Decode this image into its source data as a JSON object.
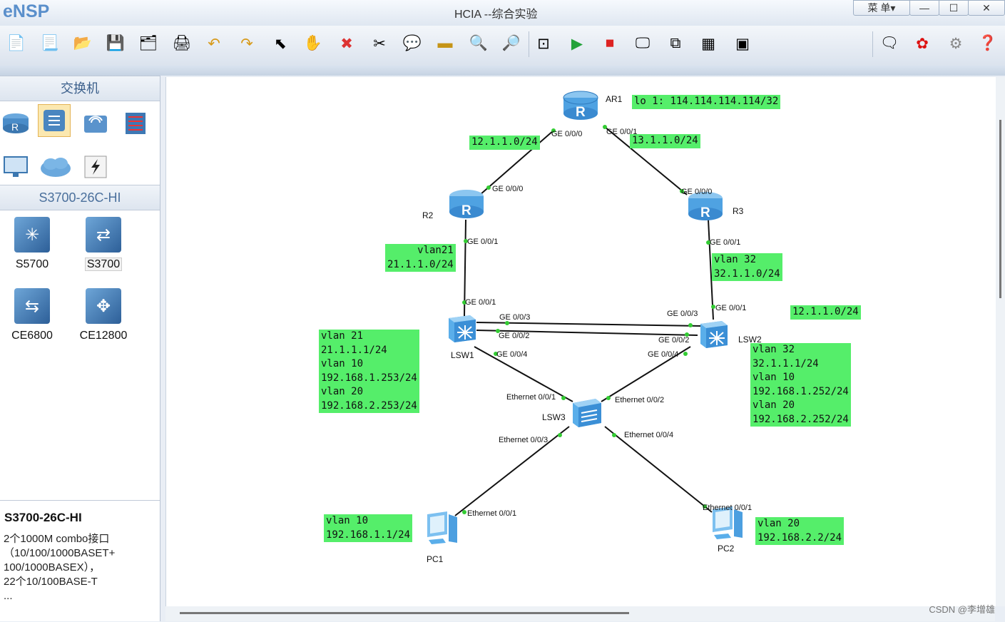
{
  "app": {
    "logo": "eNSP",
    "window_title": "HCIA --综合实验"
  },
  "window_buttons": {
    "menu": "菜 单▾",
    "minimize": "—",
    "maximize": "☐",
    "close": "✕"
  },
  "sidebar": {
    "category_title": "交换机",
    "model_title": "S3700-26C-HI",
    "devices": [
      {
        "label": "S5700"
      },
      {
        "label": "S3700"
      },
      {
        "label": "CE6800"
      },
      {
        "label": "CE12800"
      }
    ],
    "description": {
      "title": "S3700-26C-HI",
      "lines": [
        "2个1000M combo接口",
        "（10/100/1000BASET+",
        "100/1000BASEX），",
        "22个10/100BASE-T",
        "..."
      ]
    }
  },
  "topology": {
    "devices": [
      {
        "name": "AR1",
        "type": "router"
      },
      {
        "name": "R2",
        "type": "router"
      },
      {
        "name": "R3",
        "type": "router"
      },
      {
        "name": "LSW1",
        "type": "l3-switch"
      },
      {
        "name": "LSW2",
        "type": "l3-switch"
      },
      {
        "name": "LSW3",
        "type": "l2-switch"
      },
      {
        "name": "PC1",
        "type": "pc"
      },
      {
        "name": "PC2",
        "type": "pc"
      }
    ],
    "ports": {
      "ar1_g0": "GE 0/0/0",
      "ar1_g1": "GE 0/0/1",
      "r2_g0": "GE 0/0/0",
      "r2_g1": "GE 0/0/1",
      "r3_g0": "GE 0/0/0",
      "r3_g1": "GE 0/0/1",
      "lsw1_g1": "GE 0/0/1",
      "lsw1_g3": "GE 0/0/3",
      "lsw1_g2": "GE 0/0/2",
      "lsw1_g4": "GE 0/0/4",
      "lsw2_g1": "GE 0/0/1",
      "lsw2_g3": "GE 0/0/3",
      "lsw2_g2": "GE 0/0/2",
      "lsw2_g4": "GE 0/0/4",
      "lsw3_e1": "Ethernet 0/0/1",
      "lsw3_e2": "Ethernet 0/0/2",
      "lsw3_e3": "Ethernet 0/0/3",
      "lsw3_e4": "Ethernet 0/0/4",
      "pc1_e1": "Ethernet 0/0/1",
      "pc2_e1": "Ethernet 0/0/1"
    },
    "notes": {
      "ar1_lo": "lo 1: 114.114.114.114/32",
      "ar1_r2": "12.1.1.0/24",
      "ar1_r3": "13.1.1.0/24",
      "r2_lsw1": "vlan21\n21.1.1.0/24",
      "r3_lsw2": "vlan 32\n32.1.1.0/24",
      "lsw1": "vlan 21\n21.1.1.1/24\nvlan 10\n192.168.1.253/24\nvlan 20\n192.168.2.253/24",
      "lsw2": "vlan 32\n32.1.1.1/24\nvlan 10\n192.168.1.252/24\nvlan 20\n192.168.2.252/24",
      "lsw_trunk": "12.1.1.0/24",
      "pc1": "vlan 10\n192.168.1.1/24",
      "pc2": "vlan 20\n192.168.2.2/24"
    }
  },
  "watermark": "CSDN @李增雄"
}
